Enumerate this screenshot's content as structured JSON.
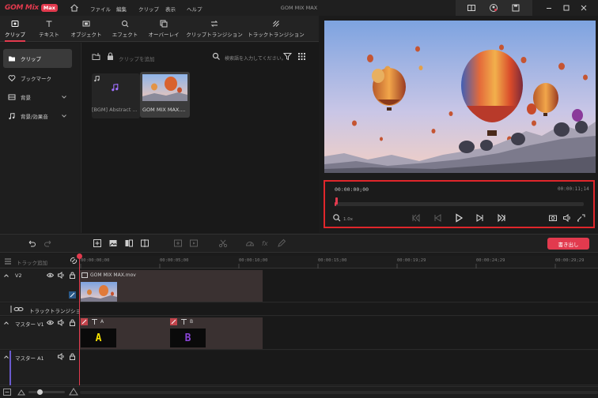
{
  "app": {
    "logo_text": "GOM Mix",
    "logo_badge": "Max",
    "title": "GOM MIX MAX",
    "accent_color": "#e23a4e",
    "highlight_color": "#e0262b"
  },
  "menu": [
    "ファイル",
    "編集",
    "クリップ",
    "表示",
    "ヘルプ"
  ],
  "tabs": [
    {
      "label": "クリップ",
      "icon": "clip-icon",
      "active": true
    },
    {
      "label": "テキスト",
      "icon": "text-icon"
    },
    {
      "label": "オブジェクト",
      "icon": "object-icon"
    },
    {
      "label": "エフェクト",
      "icon": "effect-icon"
    },
    {
      "label": "オーバーレイ",
      "icon": "overlay-icon"
    },
    {
      "label": "クリップトランジション",
      "icon": "clip-transition-icon"
    },
    {
      "label": "トラックトランジション",
      "icon": "track-transition-icon"
    }
  ],
  "sidebar": {
    "items": [
      {
        "label": "クリップ",
        "icon": "folder-icon",
        "active": true
      },
      {
        "label": "ブックマーク",
        "icon": "heart-icon"
      },
      {
        "label": "背景",
        "icon": "background-icon",
        "expandable": true
      },
      {
        "label": "背景/効果音",
        "icon": "music-icon",
        "expandable": true
      }
    ]
  },
  "media": {
    "add_clip": "クリップを追加",
    "search_placeholder": "検索語を入力してください。",
    "items": [
      {
        "label": "[BGM] Abstract ...",
        "icon": "music-note-icon"
      },
      {
        "label": "GOM MIX MAX....",
        "icon": "video-thumbnail"
      }
    ]
  },
  "player": {
    "current_time": "00:00:00;00",
    "total_time": "00:00:11;14",
    "progress": 0.005,
    "zoom": "1.0x"
  },
  "timeline": {
    "export_label": "書き出し",
    "add_track": "トラック追加",
    "ruler": [
      "00:00:00;00",
      "00:00:05;00",
      "00:00:10;00",
      "00:00:15;00",
      "00:00:19;29",
      "00:00:24;29",
      "00:00:29;29"
    ],
    "tracks": {
      "v2": {
        "name": "V2",
        "clip_label": "GOM MIX MAX.mov"
      },
      "transition": {
        "name": "トラックトランジション"
      },
      "v1": {
        "name": "マスター V1",
        "caption_a": "A",
        "caption_b": "B",
        "caption_a_color": "#f5e000",
        "caption_b_color": "#8a44d6"
      },
      "a1": {
        "name": "マスター A1"
      }
    }
  }
}
